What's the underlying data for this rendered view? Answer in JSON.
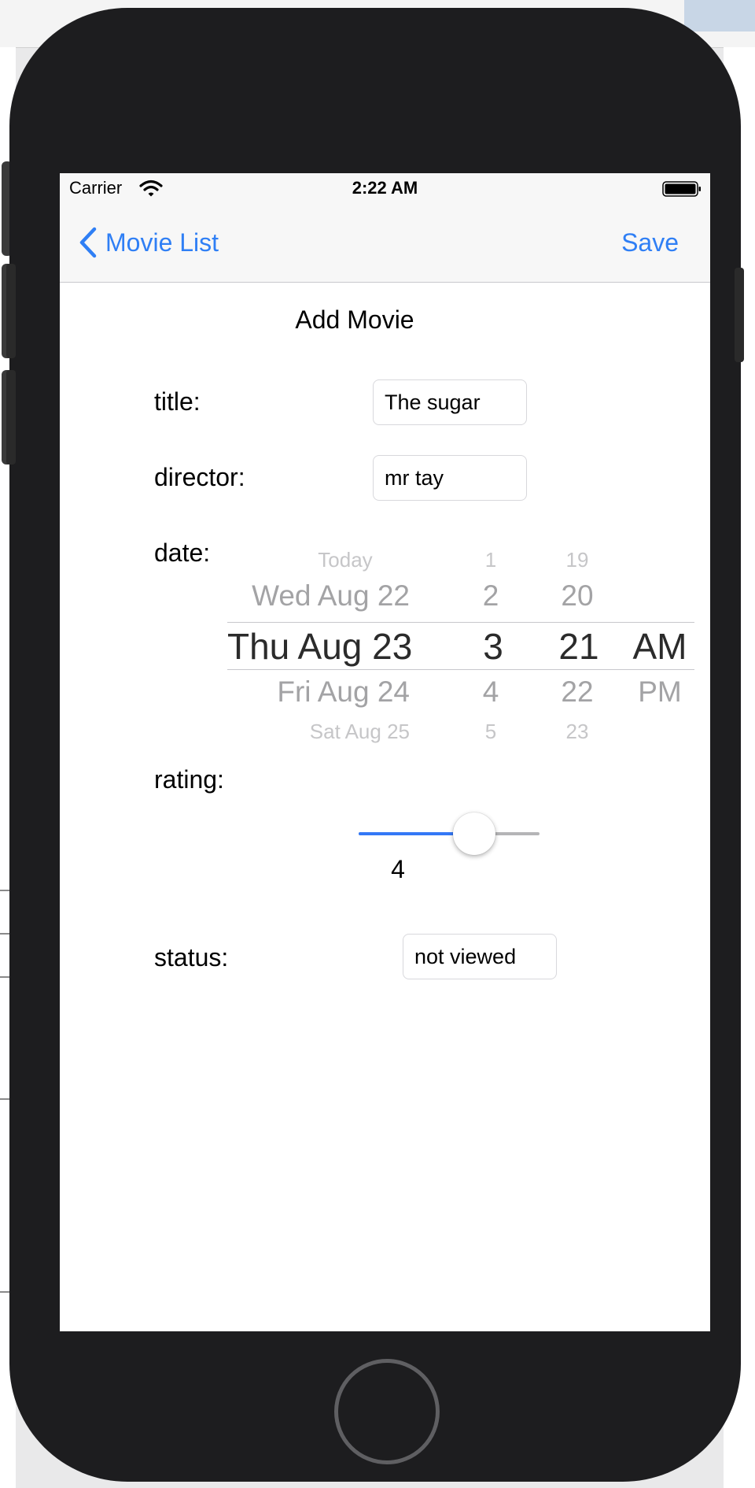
{
  "status_bar": {
    "carrier": "Carrier",
    "time": "2:22 AM"
  },
  "nav": {
    "back_label": "Movie List",
    "save_label": "Save"
  },
  "page_title": "Add Movie",
  "fields": {
    "title": {
      "label": "title:",
      "value": "The sugar"
    },
    "director": {
      "label": "director:",
      "value": "mr tay"
    },
    "date": {
      "label": "date:"
    },
    "rating": {
      "label": "rating:",
      "value": "4",
      "slider_fraction": 0.64
    },
    "status": {
      "label": "status:",
      "value": "not viewed"
    }
  },
  "date_picker": {
    "days": [
      "Today",
      "Wed Aug 22",
      "Thu Aug 23",
      "Fri Aug 24",
      "Sat Aug 25"
    ],
    "hours": [
      "1",
      "2",
      "3",
      "4",
      "5"
    ],
    "minutes": [
      "19",
      "20",
      "21",
      "22",
      "23"
    ],
    "periods": [
      "",
      "",
      "AM",
      "PM",
      ""
    ],
    "selected": {
      "day": "Thu Aug 23",
      "hour": "3",
      "minute": "21",
      "period": "AM"
    }
  },
  "colors": {
    "accent": "#2f7ff5",
    "slider_fill": "#3478f6",
    "phone_body": "#1d1d1f"
  },
  "icons": {
    "back": "chevron-left-icon",
    "wifi": "wifi-icon",
    "battery": "battery-icon",
    "home": "home-button"
  }
}
